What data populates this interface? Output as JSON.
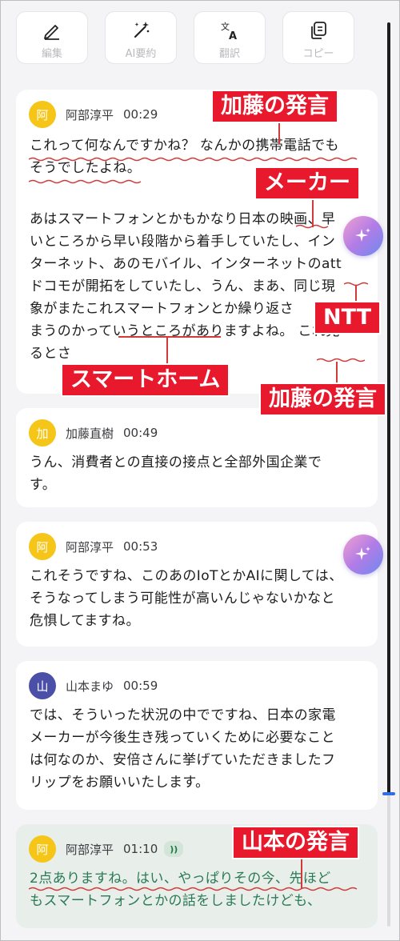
{
  "toolbar": {
    "edit": {
      "label": "編集",
      "icon": "pen-icon"
    },
    "summary": {
      "label": "AI要約",
      "icon": "magic-wand-icon"
    },
    "translate": {
      "label": "翻訳",
      "icon": "translate-icon"
    },
    "copy": {
      "label": "コピー",
      "icon": "copy-icon"
    }
  },
  "transcript": [
    {
      "speaker": "阿部淳平",
      "avatar": "阿",
      "avatar_color": "#f5c518",
      "time": "00:29",
      "paragraphs": [
        [
          "これって何なんですかね？ なんかの携帯電話でも",
          "そうでしたよね。"
        ],
        [
          "あはスマートフォンとかもかなり日本の映画、早",
          "いところから早い段階から着手していたし、イン",
          "ターネット、あのモバイル、インターネットのatt",
          "ドコモが開拓をしていたし、うん、まあ、同じ現",
          "象がまたこれスマートフォンとか繰り返さ",
          "まうのかっていうところがありますよね。 これ見",
          "るとさ"
        ]
      ]
    },
    {
      "speaker": "加藤直樹",
      "avatar": "加",
      "avatar_color": "#f5c518",
      "time": "00:49",
      "paragraphs": [
        [
          "うん、消費者との直接の接点と全部外国企業で",
          "す。"
        ]
      ]
    },
    {
      "speaker": "阿部淳平",
      "avatar": "阿",
      "avatar_color": "#f5c518",
      "time": "00:53",
      "paragraphs": [
        [
          "これそうですね、このあのIoTとかAIに関しては、",
          "そうなってしまう可能性が高いんじゃないかなと",
          "危惧してますね。"
        ]
      ]
    },
    {
      "speaker": "山本まゆ",
      "avatar": "山",
      "avatar_color": "#4b4fa8",
      "time": "00:59",
      "paragraphs": [
        [
          "では、そういった状況の中でですね、日本の家電",
          "メーカーが今後生き残っていくために必要なこと",
          "は何なのか、安倍さんに挙げていただきましたフ",
          "リップをお願いいたします。"
        ]
      ]
    },
    {
      "speaker": "阿部淳平",
      "avatar": "阿",
      "avatar_color": "#f5c518",
      "time": "01:10",
      "audio_icon": "audio-wave-icon",
      "paragraphs": [
        [
          "2点ありますね。はい、やっぱりその今、先ほど",
          "もスマートフォンとかの話をしましたけども、"
        ]
      ]
    }
  ],
  "annotations": {
    "kato_1": "加藤の発言",
    "maker": "メーカー",
    "ntt": "NTT",
    "smarthome": "スマートホーム",
    "kato_2": "加藤の発言",
    "yamamoto": "山本の発言"
  },
  "floating_buttons": [
    "sparkle-icon",
    "sparkle-icon"
  ],
  "colors": {
    "annotation_red": "#e8192c",
    "underline_red": "#d23a3a",
    "active_card": "#e8efeb",
    "active_text": "#2b7a55",
    "scroll_thumb": "#2e6fe8"
  }
}
